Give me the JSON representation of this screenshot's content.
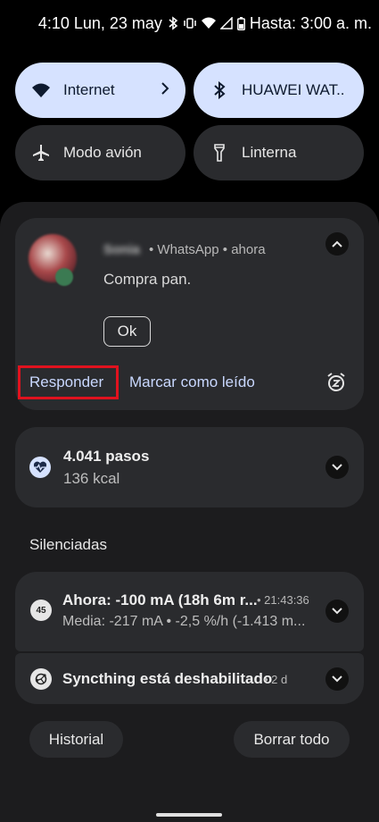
{
  "status_bar": {
    "time_date": "4:10 Lun, 23 may",
    "battery_text": "Hasta: 3:00 a. m."
  },
  "quick_settings": {
    "internet": "Internet",
    "bluetooth": "HUAWEI WAT..",
    "airplane": "Modo avión",
    "flashlight": "Linterna"
  },
  "whatsapp": {
    "sender": "Sonia",
    "meta": "• WhatsApp • ahora",
    "message": "Compra pan.",
    "ok": "Ok",
    "reply": "Responder",
    "mark_read": "Marcar como leído"
  },
  "steps": {
    "title": "4.041 pasos",
    "subtitle": "136 kcal"
  },
  "silenced_title": "Silenciadas",
  "battery_notif": {
    "icon_text": "45",
    "title": "Ahora: -100 mA (18h 6m r...",
    "time": "• 21:43:36",
    "subtitle": "Media: -217 mA • -2,5 %/h (-1.413 m..."
  },
  "syncthing": {
    "title": "Syncthing está deshabilitado",
    "time": "• 2 d"
  },
  "buttons": {
    "history": "Historial",
    "clear_all": "Borrar todo"
  },
  "colors": {
    "accent_tile": "#d6e2ff",
    "action_text": "#c9d8ff",
    "highlight": "#e0121e"
  }
}
